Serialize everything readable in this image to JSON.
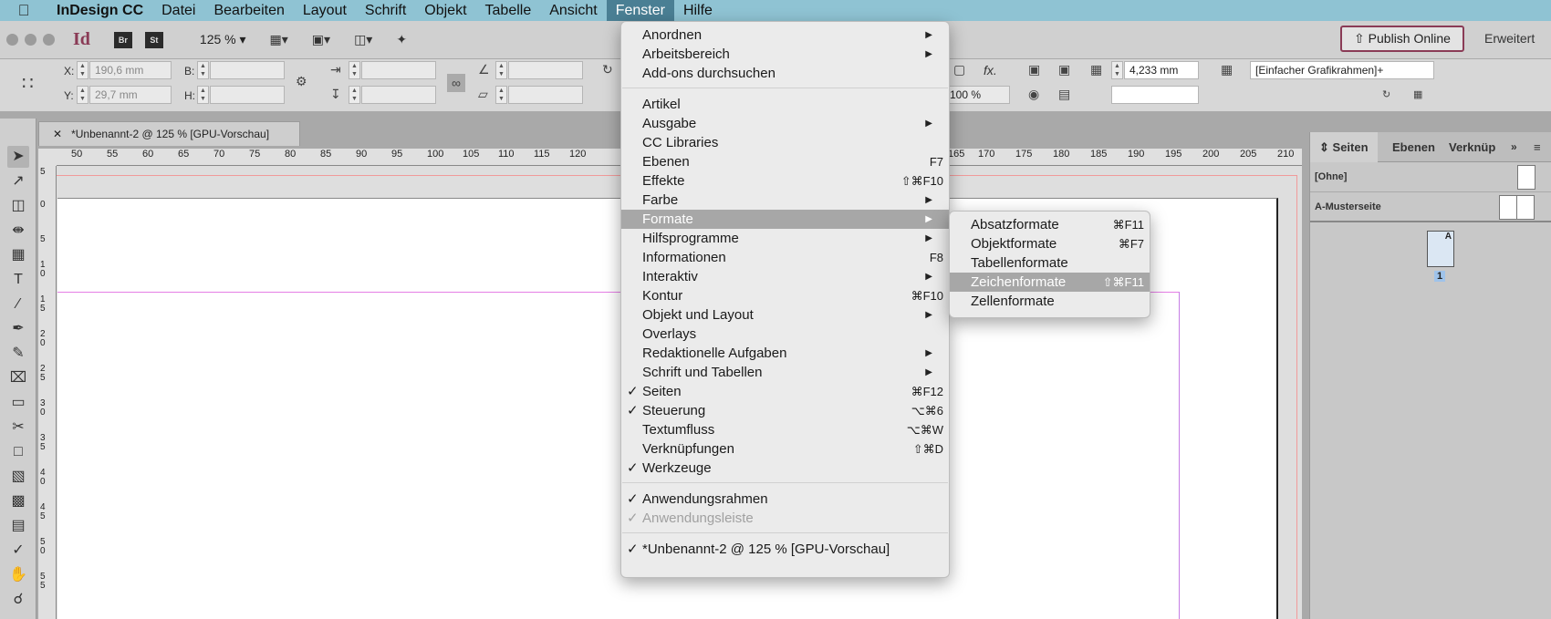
{
  "menubar": {
    "app": "InDesign CC",
    "items": [
      "Datei",
      "Bearbeiten",
      "Layout",
      "Schrift",
      "Objekt",
      "Tabelle",
      "Ansicht",
      "Fenster",
      "Hilfe"
    ]
  },
  "appbar": {
    "logo": "Id",
    "br": "Br",
    "st": "St",
    "zoom": "125 %",
    "publish": "Publish Online",
    "workspace": "Erweitert"
  },
  "control": {
    "x_label": "X:",
    "y_label": "Y:",
    "b_label": "B:",
    "h_label": "H:",
    "x_value": "190,6 mm",
    "y_value": "29,7 mm",
    "stroke_value": "4,233 mm",
    "frame_style": "[Einfacher Grafikrahmen]+",
    "opacity": "100 %",
    "fx": "fx."
  },
  "document": {
    "tab": "*Unbenannt-2 @ 125 % [GPU-Vorschau]",
    "ruler_h": [
      "50",
      "55",
      "60",
      "65",
      "70",
      "75",
      "80",
      "85",
      "90",
      "95",
      "100",
      "105",
      "110",
      "115",
      "120",
      "165",
      "170",
      "175",
      "180",
      "185",
      "190",
      "195",
      "200",
      "205",
      "210"
    ],
    "ruler_v": [
      "5",
      "0",
      "5",
      "10",
      "15",
      "20",
      "25",
      "30",
      "35",
      "40",
      "45",
      "50",
      "55"
    ]
  },
  "panel": {
    "tabs": [
      "Seiten",
      "Ebenen",
      "Verknüp"
    ],
    "none": "[Ohne]",
    "master": "A-Musterseite",
    "page_label": "A",
    "page_number": "1"
  },
  "fenster_menu": {
    "items": [
      {
        "label": "Anordnen",
        "arrow": true
      },
      {
        "label": "Arbeitsbereich",
        "arrow": true
      },
      {
        "label": "Add-ons durchsuchen"
      },
      {
        "sep": true
      },
      {
        "label": "Artikel"
      },
      {
        "label": "Ausgabe",
        "arrow": true
      },
      {
        "label": "CC Libraries"
      },
      {
        "label": "Ebenen",
        "shortcut": "F7"
      },
      {
        "label": "Effekte",
        "shortcut": "⇧⌘F10"
      },
      {
        "label": "Farbe",
        "arrow": true
      },
      {
        "label": "Formate",
        "arrow": true,
        "highlight": true
      },
      {
        "label": "Hilfsprogramme",
        "arrow": true
      },
      {
        "label": "Informationen",
        "shortcut": "F8"
      },
      {
        "label": "Interaktiv",
        "arrow": true
      },
      {
        "label": "Kontur",
        "shortcut": "⌘F10"
      },
      {
        "label": "Objekt und Layout",
        "arrow": true
      },
      {
        "label": "Overlays"
      },
      {
        "label": "Redaktionelle Aufgaben",
        "arrow": true
      },
      {
        "label": "Schrift und Tabellen",
        "arrow": true
      },
      {
        "label": "Seiten",
        "shortcut": "⌘F12",
        "checked": true
      },
      {
        "label": "Steuerung",
        "shortcut": "⌥⌘6",
        "checked": true
      },
      {
        "label": "Textumfluss",
        "shortcut": "⌥⌘W"
      },
      {
        "label": "Verknüpfungen",
        "shortcut": "⇧⌘D"
      },
      {
        "label": "Werkzeuge",
        "checked": true
      },
      {
        "sep": true
      },
      {
        "label": "Anwendungsrahmen",
        "checked": true
      },
      {
        "label": "Anwendungsleiste",
        "checked": true,
        "disabled": true
      },
      {
        "sep": true
      },
      {
        "label": "*Unbenannt-2 @ 125 % [GPU-Vorschau]",
        "checked": true
      }
    ]
  },
  "formate_menu": {
    "items": [
      {
        "label": "Absatzformate",
        "shortcut": "⌘F11"
      },
      {
        "label": "Objektformate",
        "shortcut": "⌘F7"
      },
      {
        "label": "Tabellenformate"
      },
      {
        "label": "Zeichenformate",
        "shortcut": "⇧⌘F11",
        "highlight": true
      },
      {
        "label": "Zellenformate"
      }
    ]
  }
}
